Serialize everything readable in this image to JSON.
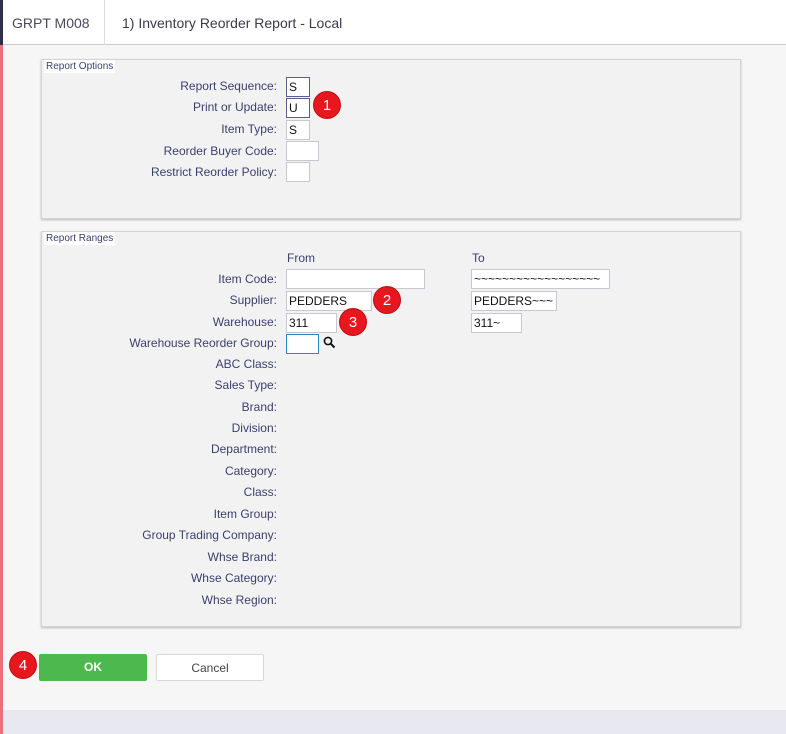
{
  "header": {
    "program_code": "GRPT M008",
    "title": "1) Inventory Reorder Report - Local"
  },
  "report_options": {
    "legend": "Report Options",
    "fields": [
      {
        "label": "Report Sequence:",
        "value": "S"
      },
      {
        "label": "Print or Update:",
        "value": "U"
      },
      {
        "label": "Item Type:",
        "value": "S"
      },
      {
        "label": "Reorder Buyer Code:",
        "value": ""
      },
      {
        "label": "Restrict Reorder Policy:",
        "value": ""
      }
    ]
  },
  "report_ranges": {
    "legend": "Report Ranges",
    "from_header": "From",
    "to_header": "To",
    "rows": [
      {
        "label": "Item Code:",
        "from": "",
        "to": "~~~~~~~~~~~~~~~~~~"
      },
      {
        "label": "Supplier:",
        "from": "PEDDERS",
        "to": "PEDDERS~~~"
      },
      {
        "label": "Warehouse:",
        "from": "311",
        "to": "311~"
      },
      {
        "label": "Warehouse Reorder Group:",
        "from": ""
      },
      {
        "label": "ABC Class:"
      },
      {
        "label": "Sales Type:"
      },
      {
        "label": "Brand:"
      },
      {
        "label": "Division:"
      },
      {
        "label": "Department:"
      },
      {
        "label": "Category:"
      },
      {
        "label": "Class:"
      },
      {
        "label": "Item Group:"
      },
      {
        "label": "Group Trading Company:"
      },
      {
        "label": "Whse Brand:"
      },
      {
        "label": "Whse Category:"
      },
      {
        "label": "Whse Region:"
      }
    ]
  },
  "annotations": [
    "1",
    "2",
    "3",
    "4"
  ],
  "buttons": {
    "ok": "OK",
    "cancel": "Cancel"
  },
  "colors": {
    "ok_green": "#4cb84e",
    "badge_red": "#e8171e",
    "accent_stripe": "#e8727a"
  }
}
